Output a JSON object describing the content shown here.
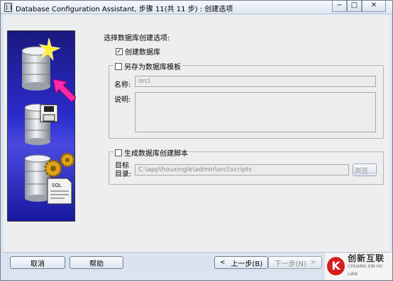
{
  "window": {
    "title": "Database Configuration Assistant, 步骤 11(共 11 步) : 创建选项",
    "controls": {
      "minimize": "−",
      "maximize": "□",
      "close": "✕"
    }
  },
  "options": {
    "prompt": "选择数据库创建选项:",
    "create_db": {
      "label": "创建数据库",
      "checked": true
    },
    "save_template": {
      "label": "另存为数据库模板",
      "checked": false,
      "name_label": "名称:",
      "name_value": "orcl",
      "desc_label": "说明:",
      "desc_value": ""
    },
    "gen_scripts": {
      "label": "生成数据库创建脚本",
      "checked": false,
      "dir_label_line1": "目标",
      "dir_label_line2": "目录:",
      "dir_value": "C:\\app\\houxingle\\admin\\orcl\\scripts",
      "browse_label": "浏览..."
    }
  },
  "footer": {
    "cancel": "取消",
    "help": "帮助",
    "back": "上一步(B)",
    "next": "下一步(N)"
  },
  "watermark": {
    "cn": "创新互联",
    "en": "CHUANG XIN HU LIAN"
  },
  "icons": [
    "database-star",
    "pointer-arrow",
    "database-floppy",
    "database-gears",
    "sql-document"
  ]
}
